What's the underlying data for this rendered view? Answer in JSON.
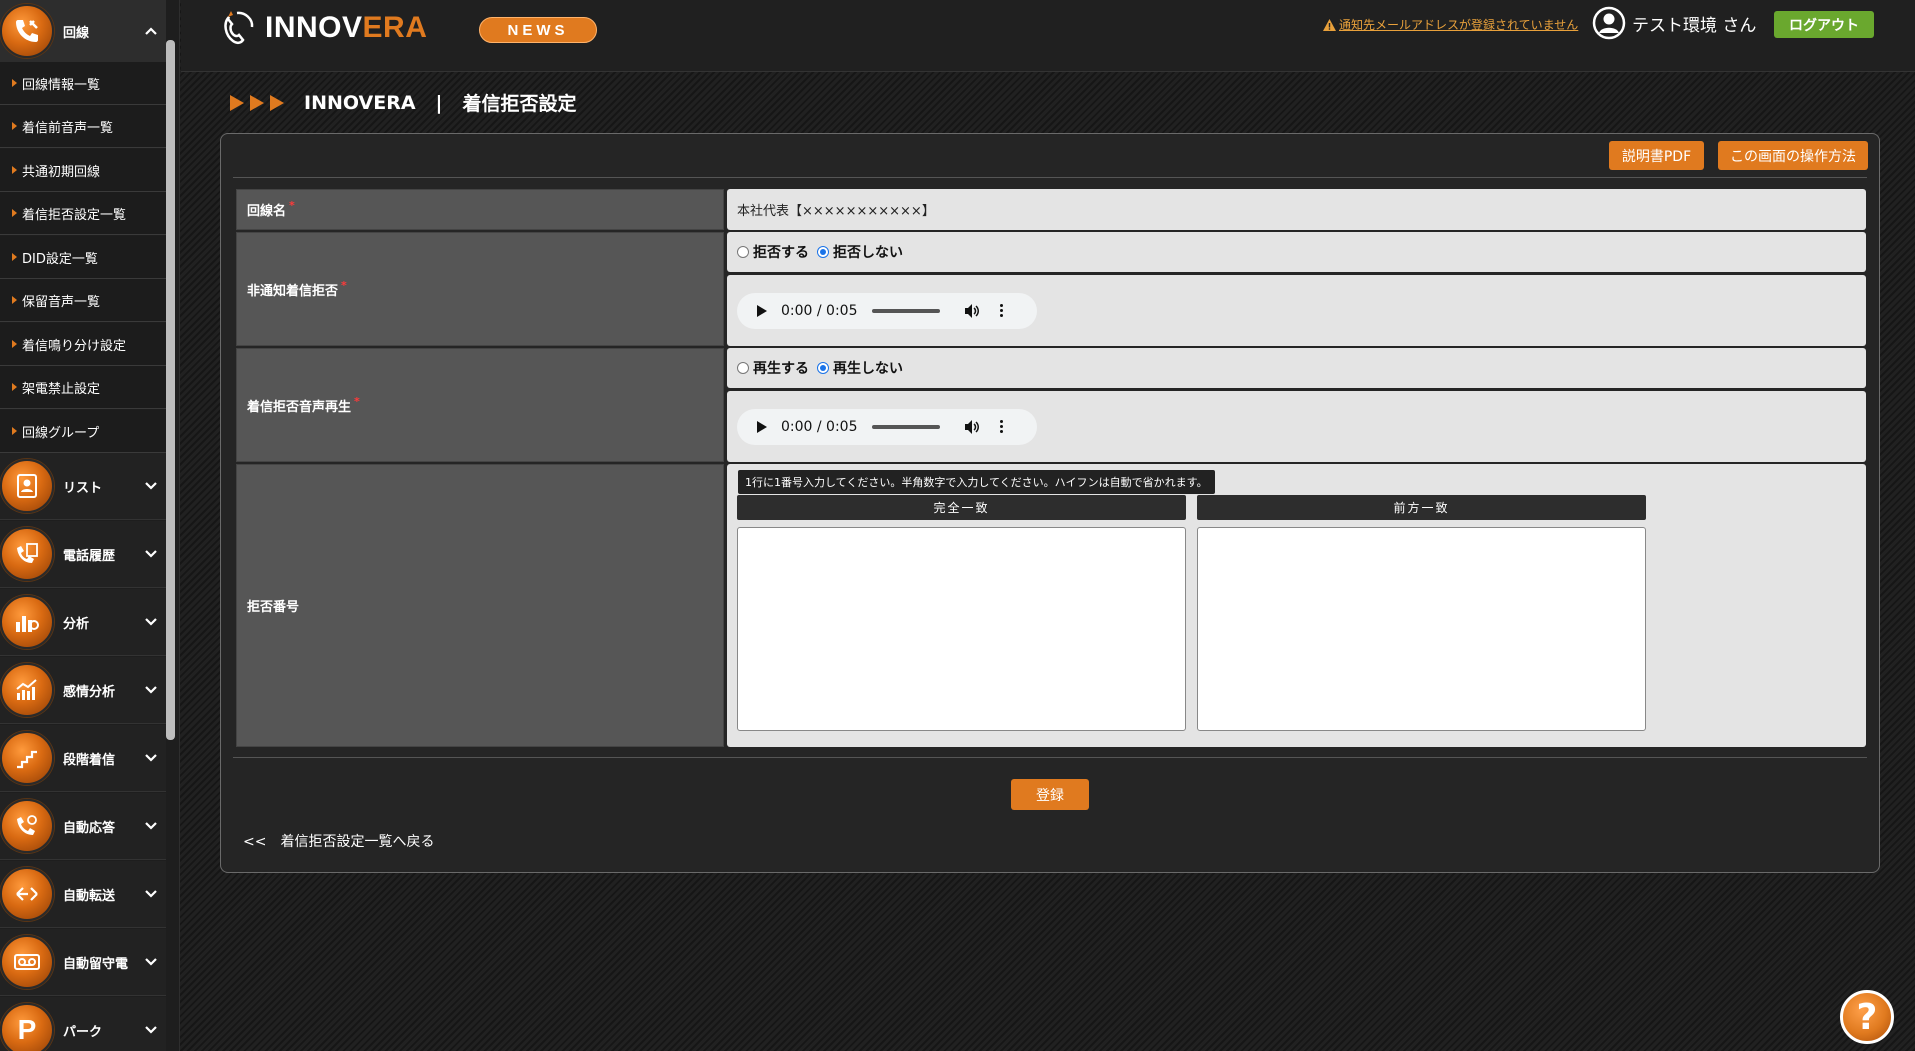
{
  "topbar": {
    "logo_main": "INNOV",
    "logo_accent": "ERA",
    "news_label": "NEWS",
    "notice": "通知先メールアドレスが登録されていません",
    "user_label": "テスト環境 さん",
    "logout_label": "ログアウト"
  },
  "sidebar": {
    "header_label": "回線",
    "sub_items": [
      "回線情報一覧",
      "着信前音声一覧",
      "共通初期回線",
      "着信拒否設定一覧",
      "DID設定一覧",
      "保留音声一覧",
      "着信鳴り分け設定",
      "架電禁止設定",
      "回線グループ"
    ],
    "categories": [
      "リスト",
      "電話履歴",
      "分析",
      "感情分析",
      "段階着信",
      "自動応答",
      "自動転送",
      "自動留守電",
      "パーク"
    ]
  },
  "breadcrumb": {
    "site": "INNOVERA",
    "separator": "|",
    "page": "着信拒否設定"
  },
  "panel": {
    "manual_pdf_label": "説明書PDF",
    "howto_label": "この画面の操作方法",
    "register_label": "登録",
    "back_label": "<<　着信拒否設定一覧へ戻る"
  },
  "form": {
    "line_name": {
      "label": "回線名",
      "value": "本社代表【×××××××××××】"
    },
    "anonymous_reject": {
      "label": "非通知着信拒否",
      "options": [
        "拒否する",
        "拒否しない"
      ],
      "selected": "拒否しない",
      "audio_time": "0:00 / 0:05"
    },
    "reject_audio": {
      "label": "着信拒否音声再生",
      "options": [
        "再生する",
        "再生しない"
      ],
      "selected": "再生しない",
      "audio_time": "0:00 / 0:05"
    },
    "reject_numbers": {
      "label": "拒否番号",
      "hint": "1行に1番号入力してください。半角数字で入力してください。ハイフンは自動で省かれます。",
      "exact_label": "完全一致",
      "prefix_label": "前方一致",
      "exact_value": "",
      "prefix_value": ""
    }
  },
  "colors": {
    "accent": "#e07a1f",
    "logout": "#6aa82e",
    "required": "#ff3a3a"
  }
}
